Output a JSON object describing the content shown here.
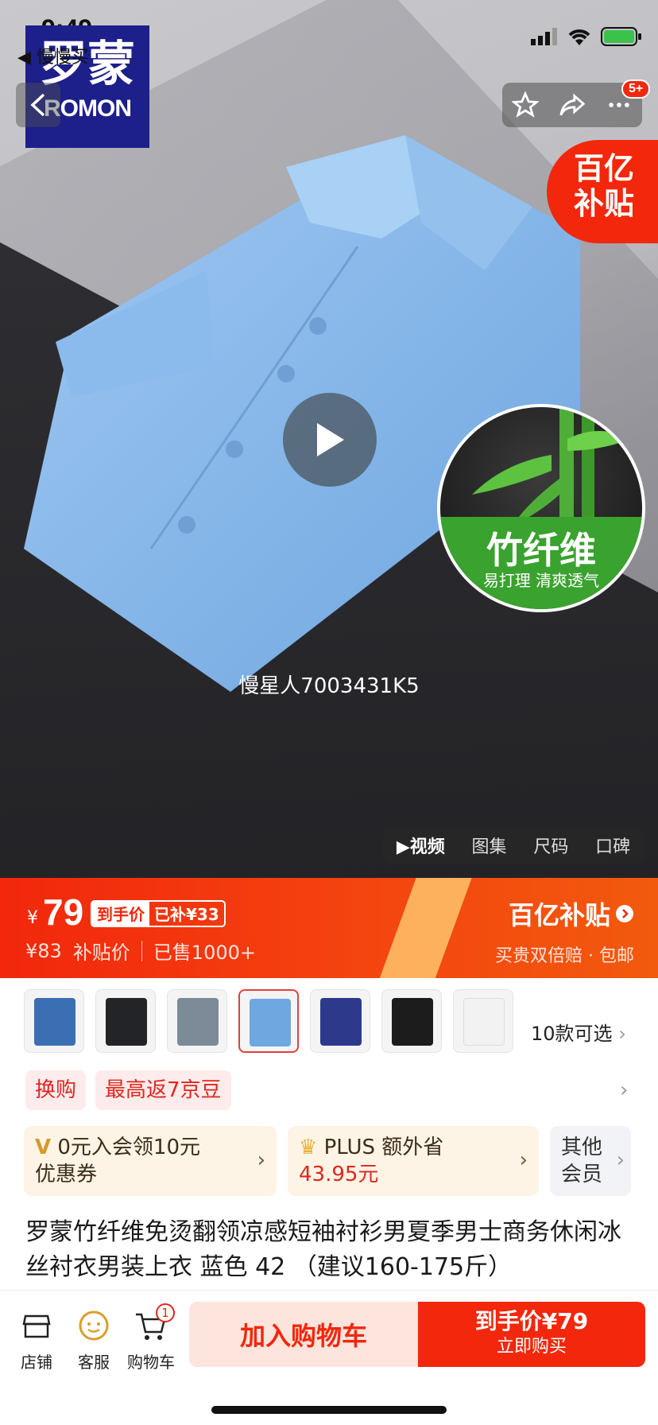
{
  "status_bar": {
    "time": "9:49",
    "back_app": "慢慢买"
  },
  "brand_logo": {
    "cn": "罗蒙",
    "en": "ROMON"
  },
  "top_actions": {
    "badge": "5+"
  },
  "subsidy_corner": {
    "line1": "百亿",
    "line2": "补贴"
  },
  "feature_badge": {
    "title": "竹纤维",
    "subtitle": "易打理 清爽透气"
  },
  "watermark": "慢星人7003431K5",
  "media_tabs": [
    {
      "label": "▶视频",
      "active": true
    },
    {
      "label": "图集",
      "active": false
    },
    {
      "label": "尺码",
      "active": false
    },
    {
      "label": "口碑",
      "active": false
    }
  ],
  "price": {
    "yen": "¥",
    "value": "79",
    "tag_label": "到手价",
    "tag_subsidy": "已补¥33",
    "original": "¥83",
    "subsidy_label": "补贴价",
    "sold": "已售1000+",
    "brand": "百亿补贴",
    "guarantee": "买贵双倍赔 · 包邮"
  },
  "colors": {
    "primary": "#f2270c",
    "swatches": [
      "#3a6fb3",
      "#222428",
      "#7d8a98",
      "#6fa8e0",
      "#2d3a8c",
      "#1c1c1c",
      "#f2f2f2"
    ]
  },
  "variants": {
    "more_label": "10款可选"
  },
  "promos": [
    "换购",
    "最高返7京豆"
  ],
  "member_cards": {
    "card1_line1": "0元入会领10元",
    "card1_line2": "优惠券",
    "card2_line1": "PLUS 额外省",
    "card2_line2": "43.95元",
    "card3_line1": "其他",
    "card3_line2": "会员"
  },
  "product_title": "罗蒙竹纤维免烫翻领凉感短袖衬衫男夏季男士商务休闲冰丝衬衣男装上衣 蓝色 42 （建议160-175斤）",
  "bottom_bar": {
    "shop": "店铺",
    "service": "客服",
    "cart": "购物车",
    "cart_count": "1",
    "add_cart": "加入购物车",
    "buy_price": "到手价¥79",
    "buy_now": "立即购买"
  }
}
